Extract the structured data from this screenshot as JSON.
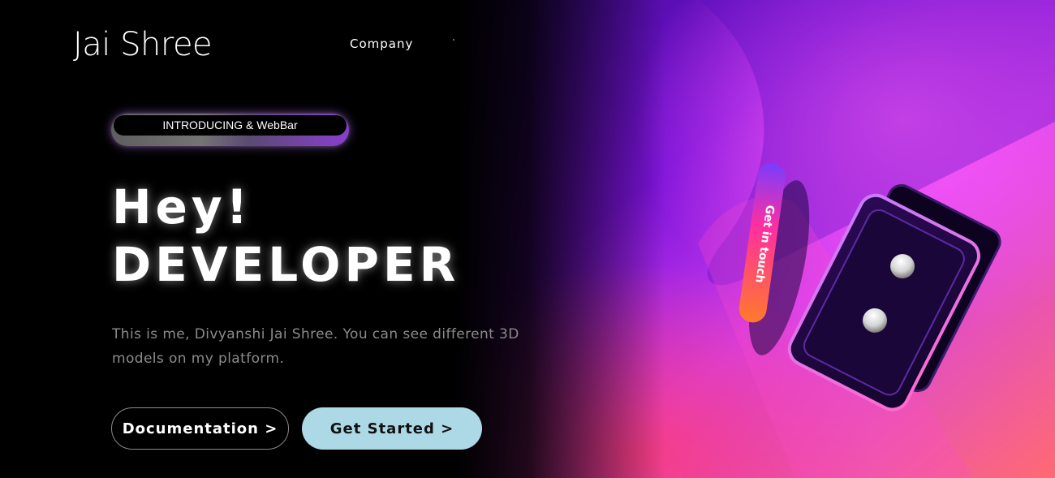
{
  "header": {
    "logo": "Jai Shree",
    "nav": [
      {
        "label": "Company"
      }
    ]
  },
  "hero": {
    "badge": "INTRODUCING & WebBar",
    "headline_line1": "Hey!",
    "headline_line2": "DEVELOPER",
    "description": "This is me, Divyanshi Jai Shree. You can see different 3D models on my platform.",
    "buttons": {
      "documentation": "Documentation >",
      "get_started": "Get Started >"
    },
    "art": {
      "pill_text": "Get in touch"
    }
  },
  "colors": {
    "background": "#000000",
    "get_started_bg": "#add8e6",
    "accent_purple": "#8a3fd0",
    "accent_pink": "#ff57e6"
  }
}
